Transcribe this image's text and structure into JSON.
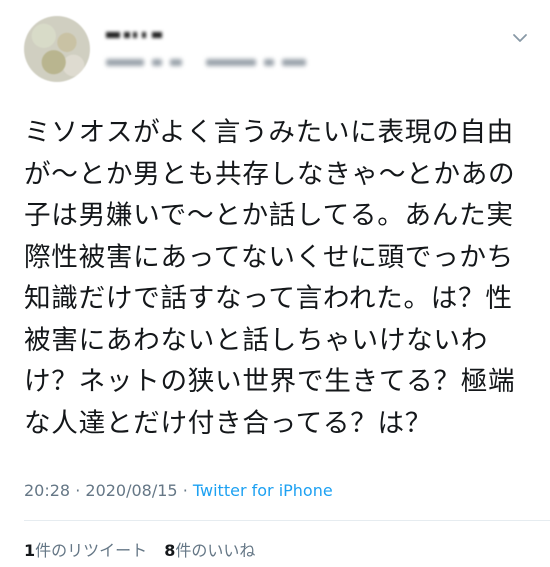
{
  "tweet": {
    "text": "ミソオスがよく言うみたいに表現の自由が〜とか男とも共存しなきゃ〜とかあの子は男嫌いで〜とか話してる。あんた実際性被害にあってないくせに頭でっかち知識だけで話すなって言われた。は？性被害にあわないと話しちゃいけないわけ？ネットの狭い世界で生きてる？極端な人達とだけ付き合ってる？は？",
    "time": "20:28",
    "date": "2020/08/15",
    "separator": "·",
    "source": "Twitter for iPhone"
  },
  "stats": {
    "retweet_count": "1",
    "retweet_label": "件のリツイート",
    "like_count": "8",
    "like_label": "件のいいね"
  },
  "icons": {
    "menu": "chevron-down-icon"
  },
  "colors": {
    "text": "#14171a",
    "secondary": "#657786",
    "link": "#1da1f2",
    "divider": "#e6ecf0"
  }
}
